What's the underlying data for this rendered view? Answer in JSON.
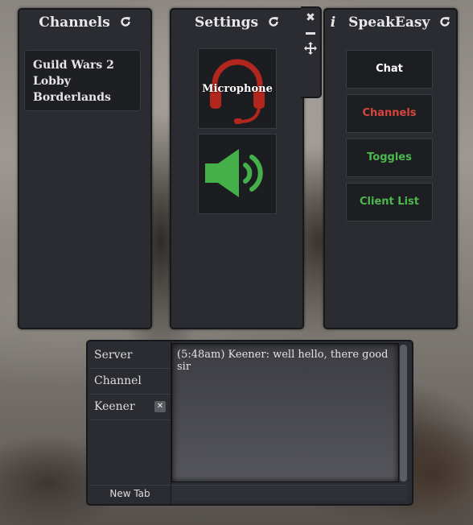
{
  "channels_panel": {
    "title": "Channels",
    "refresh_icon": "refresh-icon",
    "items": [
      "Guild Wars 2",
      "Lobby",
      "Borderlands"
    ]
  },
  "settings_panel": {
    "title": "Settings",
    "refresh_icon": "refresh-icon",
    "tab_icons": [
      "close-icon",
      "minimize-icon",
      "move-icon"
    ],
    "microphone_label": "Microphone",
    "microphone_icon": "headset-icon",
    "speaker_icon": "speaker-icon",
    "colors": {
      "microphone": "#b3261e",
      "speaker": "#45b04a"
    }
  },
  "speakeasy_panel": {
    "info_icon": "info-icon",
    "title": "SpeakEasy",
    "refresh_icon": "refresh-icon",
    "buttons": [
      {
        "label": "Chat",
        "color": "#ffffff"
      },
      {
        "label": "Channels",
        "color": "#d9453e"
      },
      {
        "label": "Toggles",
        "color": "#4cb84e"
      },
      {
        "label": "Client List",
        "color": "#4cb84e"
      }
    ]
  },
  "chat_window": {
    "tabs": [
      {
        "label": "Server"
      },
      {
        "label": "Channel"
      },
      {
        "label": "Keener",
        "close_icon": "close-icon"
      }
    ],
    "new_tab_label": "New Tab",
    "messages": [
      "(5:48am) Keener: well hello, there good sir"
    ]
  }
}
